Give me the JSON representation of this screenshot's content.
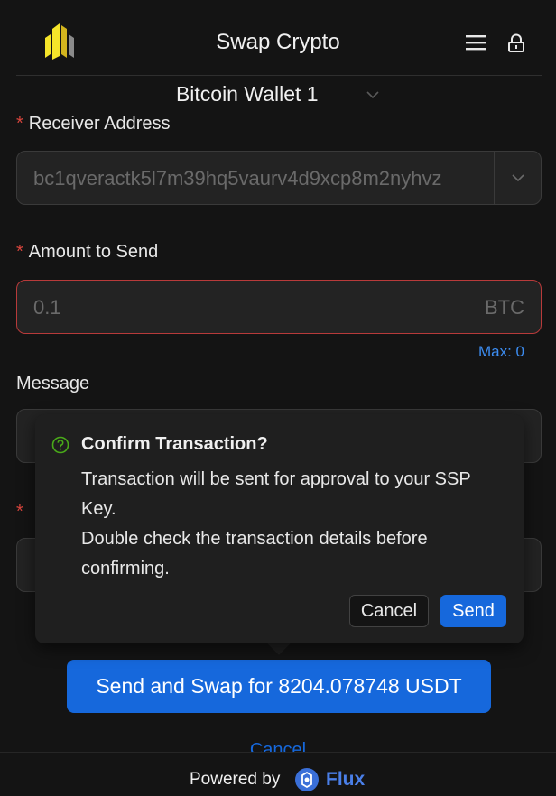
{
  "header": {
    "title": "Swap Crypto",
    "logo_icon": "ssp-logo-icon",
    "menu_icon": "hamburger-menu-icon",
    "lock_icon": "lock-icon"
  },
  "wallet": {
    "name": "Bitcoin Wallet 1"
  },
  "form": {
    "receiver": {
      "label": "Receiver Address",
      "value": "bc1qveractk5l7m39hq5vaurv4d9xcp8m2nyhvz"
    },
    "amount": {
      "label": "Amount to Send",
      "placeholder": "0.1",
      "unit": "BTC",
      "max": "Max: 0"
    },
    "message": {
      "label": "Message"
    }
  },
  "popconfirm": {
    "title": "Confirm Transaction?",
    "description_1": "Transaction will be sent for approval to your SSP Key.",
    "description_2": "Double check the transaction details before confirming.",
    "cancel_label": "Cancel",
    "send_label": "Send"
  },
  "actions": {
    "send_swap_label": "Send and Swap for 8204.078748 USDT",
    "cancel_label": "Cancel"
  },
  "footer": {
    "powered_by": "Powered by",
    "brand": "Flux"
  },
  "colors": {
    "background": "#141414",
    "accent": "#1668dc",
    "link": "#3c8cf0",
    "required": "#d8453d",
    "error_border": "#b83a3a",
    "logo_yellow": "#f5e52a",
    "confirm_icon": "#49aa19"
  }
}
